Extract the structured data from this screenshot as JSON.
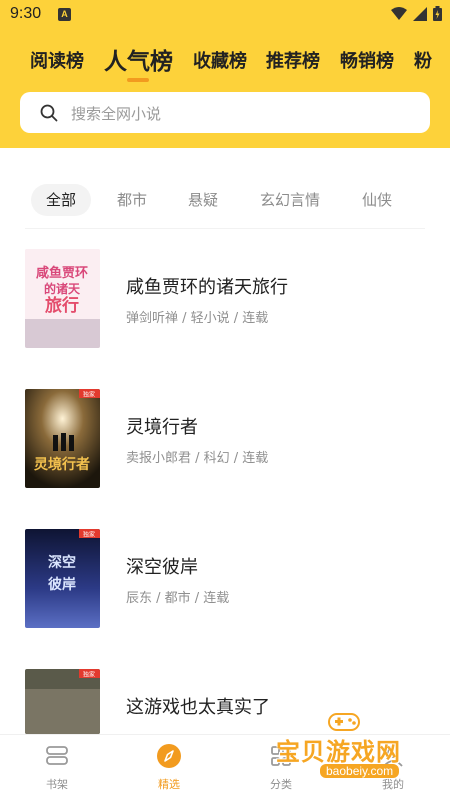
{
  "status_bar": {
    "time": "9:30",
    "notification_letter": "A"
  },
  "rank_tabs": [
    {
      "label": "阅读榜"
    },
    {
      "label": "人气榜"
    },
    {
      "label": "收藏榜"
    },
    {
      "label": "推荐榜"
    },
    {
      "label": "畅销榜"
    },
    {
      "label": "粉"
    }
  ],
  "search": {
    "placeholder": "搜索全网小说"
  },
  "category_tabs": [
    {
      "label": "全部"
    },
    {
      "label": "都市"
    },
    {
      "label": "悬疑"
    },
    {
      "label": "玄幻言情"
    },
    {
      "label": "仙侠"
    }
  ],
  "books": [
    {
      "title": "咸鱼贾环的诸天旅行",
      "meta": "弹剑听禅 / 轻小说 / 连载",
      "cover_text": "咸鱼贾环的诸天旅行",
      "cover_color": "#fbeef2"
    },
    {
      "title": "灵境行者",
      "meta": "卖报小郎君 / 科幻 / 连载",
      "cover_text": "灵境行者",
      "cover_color": "#2b2417"
    },
    {
      "title": "深空彼岸",
      "meta": "辰东 / 都市 / 连载",
      "cover_text": "深空彼岸",
      "cover_color": "#1c2450"
    },
    {
      "title": "这游戏也太真实了",
      "meta": "",
      "cover_text": "",
      "cover_color": "#5a5a4a"
    }
  ],
  "cover_badge": "独家",
  "bottom_nav": [
    {
      "label": "书架",
      "icon": "bookshelf-icon"
    },
    {
      "label": "精选",
      "icon": "compass-icon"
    },
    {
      "label": "分类",
      "icon": "category-icon"
    },
    {
      "label": "我的",
      "icon": "profile-icon"
    }
  ],
  "watermark": {
    "text": "宝贝游戏网",
    "url": "baobeiy.com"
  },
  "colors": {
    "accent": "#fdd23a",
    "active_orange": "#f29b1f"
  }
}
